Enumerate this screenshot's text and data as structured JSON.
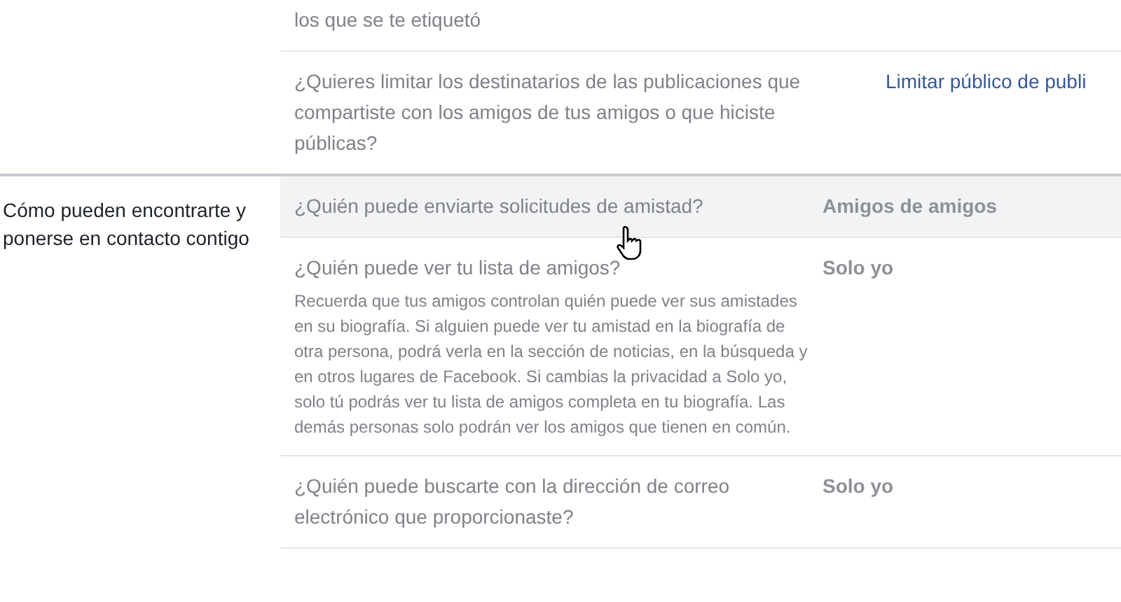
{
  "sections": [
    {
      "rows": [
        {
          "question": "los que se te etiquetó",
          "hovered": false
        },
        {
          "question": "¿Quieres limitar los destinatarios de las publicaciones que compartiste con los amigos de tus amigos o que hiciste públicas?",
          "action": {
            "kind": "link",
            "text": "Limitar público de publi"
          },
          "hovered": false
        }
      ]
    },
    {
      "label": "Cómo pueden encontrarte y ponerse en contacto contigo",
      "rows": [
        {
          "question": "¿Quién puede enviarte solicitudes de amistad?",
          "action": {
            "kind": "value",
            "text": "Amigos de amigos"
          },
          "hovered": true
        },
        {
          "question": "¿Quién puede ver tu lista de amigos?",
          "description": "Recuerda que tus amigos controlan quién puede ver sus amistades en su biografía. Si alguien puede ver tu amistad en la biografía de otra persona, podrá verla en la sección de noticias, en la búsqueda y en otros lugares de Facebook. Si cambias la privacidad a Solo yo, solo tú podrás ver tu lista de amigos completa en tu biografía. Las demás personas solo podrán ver los amigos que tienen en común.",
          "action": {
            "kind": "value",
            "text": "Solo yo"
          },
          "hovered": false
        },
        {
          "question": "¿Quién puede buscarte con la dirección de correo electrónico que proporcionaste?",
          "action": {
            "kind": "value",
            "text": "Solo yo"
          },
          "hovered": false
        }
      ]
    }
  ]
}
